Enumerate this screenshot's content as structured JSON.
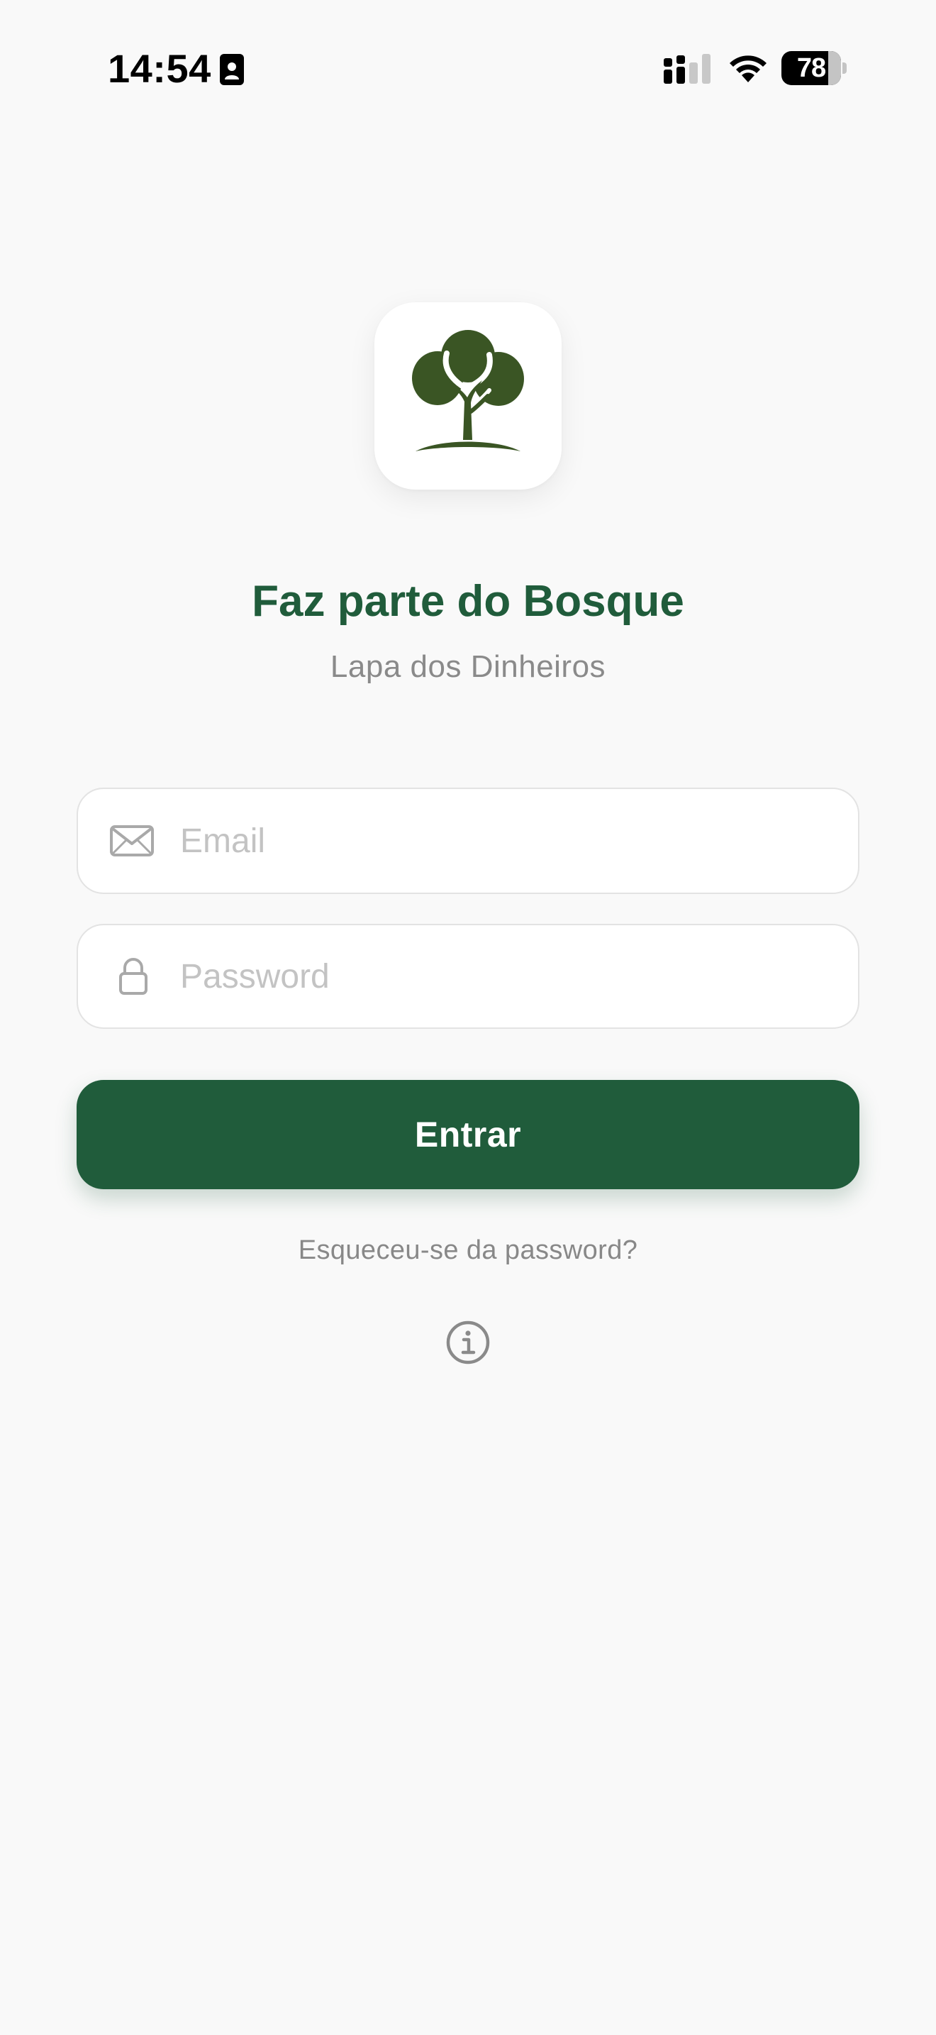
{
  "status_bar": {
    "time": "14:54",
    "battery_level": "78",
    "battery_fraction": 0.78,
    "icons": [
      "id-badge-icon",
      "signal-icon",
      "wifi-icon",
      "battery-icon"
    ]
  },
  "logo": {
    "icon": "tree-icon",
    "color": "#3a5524"
  },
  "header": {
    "title": "Faz parte do Bosque",
    "subtitle": "Lapa dos Dinheiros"
  },
  "form": {
    "email": {
      "placeholder": "Email",
      "value": "",
      "icon": "envelope-icon"
    },
    "password": {
      "placeholder": "Password",
      "value": "",
      "icon": "lock-icon"
    },
    "submit_label": "Entrar",
    "forgot_label": "Esqueceu-se da password?"
  },
  "info": {
    "icon": "info-icon"
  },
  "colors": {
    "accent": "#205c3b",
    "background": "#f9f9f9",
    "muted_text": "#888888",
    "placeholder": "#c3c3c3"
  }
}
